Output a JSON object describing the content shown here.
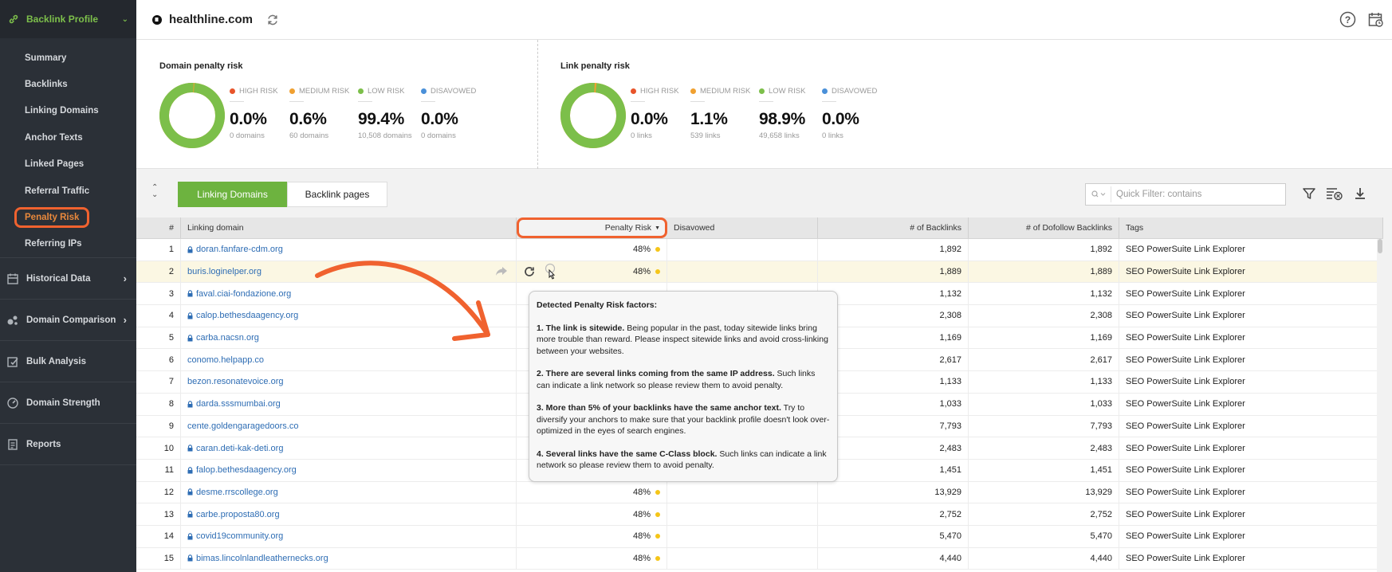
{
  "sidebar": {
    "header": "Backlink Profile",
    "sub_items": [
      "Summary",
      "Backlinks",
      "Linking Domains",
      "Anchor Texts",
      "Linked Pages",
      "Referral Traffic",
      "Penalty Risk",
      "Referring IPs"
    ],
    "active_item": "Penalty Risk",
    "main_items": [
      {
        "label": "Historical Data",
        "icon": "calendar-icon",
        "has_arrow": true
      },
      {
        "label": "Domain Comparison",
        "icon": "bubbles-icon",
        "has_arrow": true
      },
      {
        "label": "Bulk Analysis",
        "icon": "bulk-edit-icon",
        "has_arrow": false
      },
      {
        "label": "Domain Strength",
        "icon": "gauge-icon",
        "has_arrow": false
      },
      {
        "label": "Reports",
        "icon": "reports-icon",
        "has_arrow": false
      }
    ]
  },
  "topbar": {
    "domain": "healthline.com"
  },
  "domain_penalty": {
    "title": "Domain penalty risk",
    "metrics": [
      {
        "label": "HIGH RISK",
        "value": "0.0%",
        "sub": "0 domains",
        "color": "#e8542a"
      },
      {
        "label": "MEDIUM RISK",
        "value": "0.6%",
        "sub": "60 domains",
        "color": "#f0a030"
      },
      {
        "label": "LOW RISK",
        "value": "99.4%",
        "sub": "10,508 domains",
        "color": "#7cbf4a"
      },
      {
        "label": "DISAVOWED",
        "value": "0.0%",
        "sub": "0 domains",
        "color": "#4a90d9"
      }
    ],
    "low_share": 0.994
  },
  "link_penalty": {
    "title": "Link penalty risk",
    "metrics": [
      {
        "label": "HIGH RISK",
        "value": "0.0%",
        "sub": "0 links",
        "color": "#e8542a"
      },
      {
        "label": "MEDIUM RISK",
        "value": "1.1%",
        "sub": "539 links",
        "color": "#f0a030"
      },
      {
        "label": "LOW RISK",
        "value": "98.9%",
        "sub": "49,658 links",
        "color": "#7cbf4a"
      },
      {
        "label": "DISAVOWED",
        "value": "0.0%",
        "sub": "0 links",
        "color": "#4a90d9"
      }
    ],
    "low_share": 0.989
  },
  "tabs": [
    {
      "label": "Linking Domains",
      "active": true
    },
    {
      "label": "Backlink pages",
      "active": false
    }
  ],
  "filter": {
    "placeholder": "Quick Filter: contains"
  },
  "columns": [
    "#",
    "Linking domain",
    "Penalty Risk",
    "Disavowed",
    "# of Backlinks",
    "# of Dofollow Backlinks",
    "Tags"
  ],
  "rows": [
    {
      "n": "1",
      "domain": "doran.fanfare-cdm.org",
      "lock": true,
      "risk": "48%",
      "backlinks": "1,892",
      "dofollow": "1,892",
      "tag": "SEO PowerSuite Link Explorer"
    },
    {
      "n": "2",
      "domain": "buris.loginelper.org",
      "lock": false,
      "risk": "48%",
      "backlinks": "1,889",
      "dofollow": "1,889",
      "tag": "SEO PowerSuite Link Explorer"
    },
    {
      "n": "3",
      "domain": "faval.ciai-fondazione.org",
      "lock": true,
      "risk": "",
      "backlinks": "1,132",
      "dofollow": "1,132",
      "tag": "SEO PowerSuite Link Explorer"
    },
    {
      "n": "4",
      "domain": "calop.bethesdaagency.org",
      "lock": true,
      "risk": "",
      "backlinks": "2,308",
      "dofollow": "2,308",
      "tag": "SEO PowerSuite Link Explorer"
    },
    {
      "n": "5",
      "domain": "carba.nacsn.org",
      "lock": true,
      "risk": "",
      "backlinks": "1,169",
      "dofollow": "1,169",
      "tag": "SEO PowerSuite Link Explorer"
    },
    {
      "n": "6",
      "domain": "conomo.helpapp.co",
      "lock": false,
      "risk": "",
      "backlinks": "2,617",
      "dofollow": "2,617",
      "tag": "SEO PowerSuite Link Explorer"
    },
    {
      "n": "7",
      "domain": "bezon.resonatevoice.org",
      "lock": false,
      "risk": "",
      "backlinks": "1,133",
      "dofollow": "1,133",
      "tag": "SEO PowerSuite Link Explorer"
    },
    {
      "n": "8",
      "domain": "darda.sssmumbai.org",
      "lock": true,
      "risk": "",
      "backlinks": "1,033",
      "dofollow": "1,033",
      "tag": "SEO PowerSuite Link Explorer"
    },
    {
      "n": "9",
      "domain": "cente.goldengaragedoors.co",
      "lock": false,
      "risk": "",
      "backlinks": "7,793",
      "dofollow": "7,793",
      "tag": "SEO PowerSuite Link Explorer"
    },
    {
      "n": "10",
      "domain": "caran.deti-kak-deti.org",
      "lock": true,
      "risk": "",
      "backlinks": "2,483",
      "dofollow": "2,483",
      "tag": "SEO PowerSuite Link Explorer"
    },
    {
      "n": "11",
      "domain": "falop.bethesdaagency.org",
      "lock": true,
      "risk": "",
      "backlinks": "1,451",
      "dofollow": "1,451",
      "tag": "SEO PowerSuite Link Explorer"
    },
    {
      "n": "12",
      "domain": "desme.rrscollege.org",
      "lock": true,
      "risk": "48%",
      "backlinks": "13,929",
      "dofollow": "13,929",
      "tag": "SEO PowerSuite Link Explorer"
    },
    {
      "n": "13",
      "domain": "carbe.proposta80.org",
      "lock": true,
      "risk": "48%",
      "backlinks": "2,752",
      "dofollow": "2,752",
      "tag": "SEO PowerSuite Link Explorer"
    },
    {
      "n": "14",
      "domain": "covid19community.org",
      "lock": true,
      "risk": "48%",
      "backlinks": "5,470",
      "dofollow": "5,470",
      "tag": "SEO PowerSuite Link Explorer"
    },
    {
      "n": "15",
      "domain": "bimas.lincolnlandleathernecks.org",
      "lock": true,
      "risk": "48%",
      "backlinks": "4,440",
      "dofollow": "4,440",
      "tag": "SEO PowerSuite Link Explorer"
    }
  ],
  "tooltip": {
    "title": "Detected Penalty Risk factors:",
    "factors": [
      {
        "bold": "1. The link is sitewide.",
        "text": " Being popular in the past, today sitewide links bring more trouble than reward. Please inspect sitewide links and avoid cross-linking between your websites."
      },
      {
        "bold": "2. There are several links coming from the same IP address.",
        "text": " Such links can indicate a link network so please review them to avoid penalty."
      },
      {
        "bold": "3. More than 5% of your backlinks have the same anchor text.",
        "text": " Try to diversify your anchors to make sure that your backlink profile doesn't look over-optimized in the eyes of search engines."
      },
      {
        "bold": "4. Several links have the same C-Class block.",
        "text": " Such links can indicate a link network so please review them to avoid penalty."
      }
    ]
  },
  "colors": {
    "accent_green": "#6db33f",
    "highlight_orange": "#f0622f",
    "risk_yellow": "#f5c518"
  }
}
